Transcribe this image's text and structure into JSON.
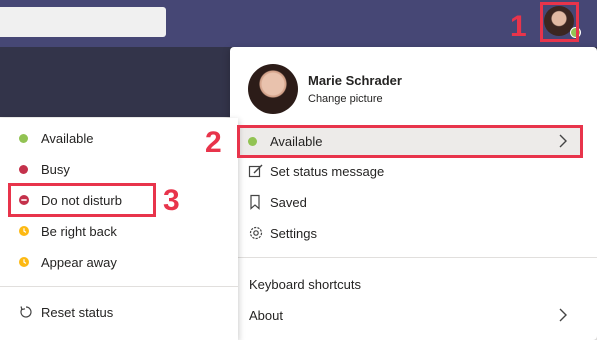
{
  "profile": {
    "name": "Marie Schrader",
    "change_picture": "Change picture"
  },
  "menu": {
    "available": "Available",
    "set_status_message": "Set status message",
    "saved": "Saved",
    "settings": "Settings",
    "keyboard_shortcuts": "Keyboard shortcuts",
    "about": "About"
  },
  "status_menu": {
    "items": [
      {
        "label": "Available",
        "icon": "available-dot",
        "color": "#92c353"
      },
      {
        "label": "Busy",
        "icon": "busy-dot",
        "color": "#c4314b"
      },
      {
        "label": "Do not disturb",
        "icon": "do-not-disturb-icon",
        "color": "#c4314b"
      },
      {
        "label": "Be right back",
        "icon": "clock-dot",
        "color": "#fdb913"
      },
      {
        "label": "Appear away",
        "icon": "clock-dot",
        "color": "#fdb913"
      }
    ],
    "reset_status": "Reset status"
  },
  "annotations": {
    "step1": "1",
    "step2": "2",
    "step3": "3",
    "color": "#e8344b"
  },
  "colors": {
    "topbar": "#464775",
    "available": "#92c353",
    "busy": "#c4314b",
    "away": "#fdb913"
  }
}
